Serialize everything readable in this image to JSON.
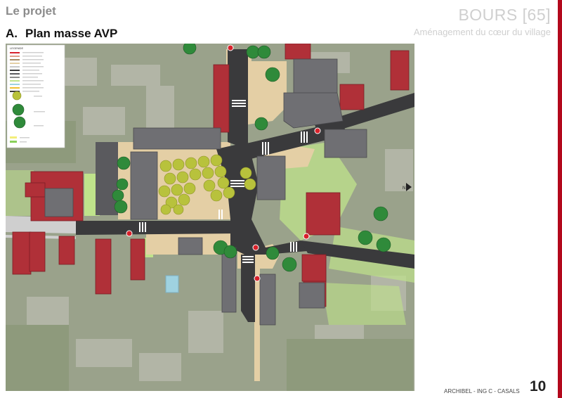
{
  "header": {
    "section_tag": "Le projet",
    "heading_number": "A.",
    "heading_text": "Plan masse AVP",
    "place": "BOURS [65]",
    "subtitle": "Aménagement du cœur du village"
  },
  "footer": {
    "credits": "ARCHIBEL - ING C - CASALS",
    "page_number": "10"
  },
  "map": {
    "north_arrow": "N",
    "legend_heading": "LEGENDE"
  },
  "colors": {
    "accent_bar": "#b3081c",
    "road": "#3a3a3c",
    "pedestrian_paving": "#e4cfa5",
    "lawn": "#bfe38b",
    "building_roof_red": "#b03038",
    "building_roof_grey": "#6f6f73",
    "stop_sign": "#d8222b"
  }
}
